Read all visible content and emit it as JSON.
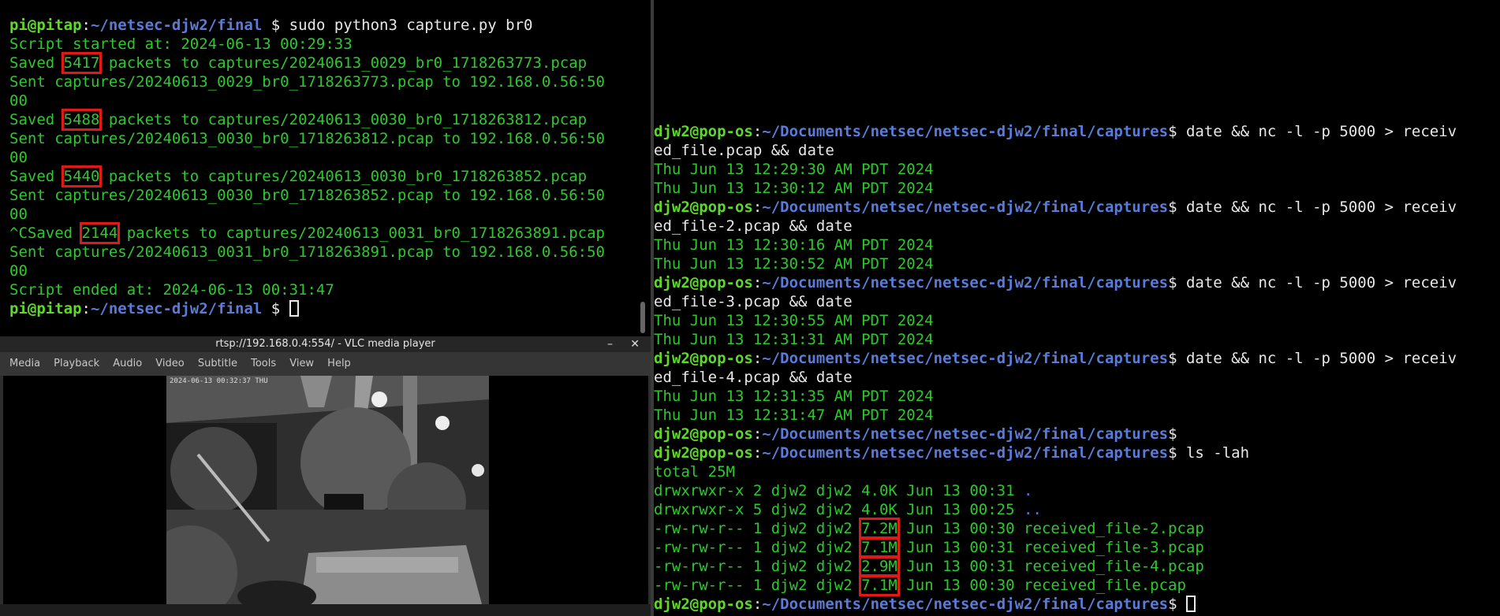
{
  "left_terminal": {
    "lines": [
      [
        {
          "t": "pi@pitap",
          "c": "gb"
        },
        {
          "t": ":",
          "c": "w"
        },
        {
          "t": "~/netsec-djw2/final",
          "c": "bb"
        },
        {
          "t": " $ ",
          "c": "w"
        },
        {
          "t": "sudo python3 capture.py br0",
          "c": "w"
        }
      ],
      [
        {
          "t": "Script started at: 2024-06-13 00:29:33",
          "c": "g"
        }
      ],
      [
        {
          "t": "Saved ",
          "c": "g"
        },
        {
          "t": "5417",
          "c": "g",
          "h": true
        },
        {
          "t": " packets to captures/20240613_0029_br0_1718263773.pcap",
          "c": "g"
        }
      ],
      [
        {
          "t": "Sent captures/20240613_0029_br0_1718263773.pcap to 192.168.0.56:50",
          "c": "g"
        }
      ],
      [
        {
          "t": "00",
          "c": "g"
        }
      ],
      [
        {
          "t": "Saved ",
          "c": "g"
        },
        {
          "t": "5488",
          "c": "g",
          "h": true
        },
        {
          "t": " packets to captures/20240613_0030_br0_1718263812.pcap",
          "c": "g"
        }
      ],
      [
        {
          "t": "Sent captures/20240613_0030_br0_1718263812.pcap to 192.168.0.56:50",
          "c": "g"
        }
      ],
      [
        {
          "t": "00",
          "c": "g"
        }
      ],
      [
        {
          "t": "Saved ",
          "c": "g"
        },
        {
          "t": "5440",
          "c": "g",
          "h": true
        },
        {
          "t": " packets to captures/20240613_0030_br0_1718263852.pcap",
          "c": "g"
        }
      ],
      [
        {
          "t": "Sent captures/20240613_0030_br0_1718263852.pcap to 192.168.0.56:50",
          "c": "g"
        }
      ],
      [
        {
          "t": "00",
          "c": "g"
        }
      ],
      [
        {
          "t": "^CSaved ",
          "c": "g"
        },
        {
          "t": "2144",
          "c": "g",
          "h": true
        },
        {
          "t": " packets to captures/20240613_0031_br0_1718263891.pcap",
          "c": "g"
        }
      ],
      [
        {
          "t": "Sent captures/20240613_0031_br0_1718263891.pcap to 192.168.0.56:50",
          "c": "g"
        }
      ],
      [
        {
          "t": "00",
          "c": "g"
        }
      ],
      [
        {
          "t": "Script ended at: 2024-06-13 00:31:47",
          "c": "g"
        }
      ],
      [
        {
          "t": "pi@pitap",
          "c": "gb"
        },
        {
          "t": ":",
          "c": "w"
        },
        {
          "t": "~/netsec-djw2/final",
          "c": "bb"
        },
        {
          "t": " $ ",
          "c": "w"
        },
        {
          "cursor": true
        }
      ]
    ]
  },
  "right_terminal": {
    "lines": [
      [
        {
          "t": "djw2@pop-os",
          "c": "gb"
        },
        {
          "t": ":",
          "c": "w"
        },
        {
          "t": "~/Documents/netsec/netsec-djw2/final/captures",
          "c": "bb"
        },
        {
          "t": "$ ",
          "c": "w"
        },
        {
          "t": "date && nc -l -p 5000 > receiv",
          "c": "w"
        }
      ],
      [
        {
          "t": "ed_file.pcap && date",
          "c": "w"
        }
      ],
      [
        {
          "t": "Thu Jun 13 12:29:30 AM PDT 2024",
          "c": "g"
        }
      ],
      [
        {
          "t": "Thu Jun 13 12:30:12 AM PDT 2024",
          "c": "g"
        }
      ],
      [
        {
          "t": "djw2@pop-os",
          "c": "gb"
        },
        {
          "t": ":",
          "c": "w"
        },
        {
          "t": "~/Documents/netsec/netsec-djw2/final/captures",
          "c": "bb"
        },
        {
          "t": "$ ",
          "c": "w"
        },
        {
          "t": "date && nc -l -p 5000 > receiv",
          "c": "w"
        }
      ],
      [
        {
          "t": "ed_file-2.pcap && date",
          "c": "w"
        }
      ],
      [
        {
          "t": "Thu Jun 13 12:30:16 AM PDT 2024",
          "c": "g"
        }
      ],
      [
        {
          "t": "Thu Jun 13 12:30:52 AM PDT 2024",
          "c": "g"
        }
      ],
      [
        {
          "t": "djw2@pop-os",
          "c": "gb"
        },
        {
          "t": ":",
          "c": "w"
        },
        {
          "t": "~/Documents/netsec/netsec-djw2/final/captures",
          "c": "bb"
        },
        {
          "t": "$ ",
          "c": "w"
        },
        {
          "t": "date && nc -l -p 5000 > receiv",
          "c": "w"
        }
      ],
      [
        {
          "t": "ed_file-3.pcap && date",
          "c": "w"
        }
      ],
      [
        {
          "t": "Thu Jun 13 12:30:55 AM PDT 2024",
          "c": "g"
        }
      ],
      [
        {
          "t": "Thu Jun 13 12:31:31 AM PDT 2024",
          "c": "g"
        }
      ],
      [
        {
          "t": "djw2@pop-os",
          "c": "gb"
        },
        {
          "t": ":",
          "c": "w"
        },
        {
          "t": "~/Documents/netsec/netsec-djw2/final/captures",
          "c": "bb"
        },
        {
          "t": "$ ",
          "c": "w"
        },
        {
          "t": "date && nc -l -p 5000 > receiv",
          "c": "w"
        }
      ],
      [
        {
          "t": "ed_file-4.pcap && date",
          "c": "w"
        }
      ],
      [
        {
          "t": "Thu Jun 13 12:31:35 AM PDT 2024",
          "c": "g"
        }
      ],
      [
        {
          "t": "Thu Jun 13 12:31:47 AM PDT 2024",
          "c": "g"
        }
      ],
      [
        {
          "t": "djw2@pop-os",
          "c": "gb"
        },
        {
          "t": ":",
          "c": "w"
        },
        {
          "t": "~/Documents/netsec/netsec-djw2/final/captures",
          "c": "bb"
        },
        {
          "t": "$",
          "c": "w"
        }
      ],
      [
        {
          "t": "djw2@pop-os",
          "c": "gb"
        },
        {
          "t": ":",
          "c": "w"
        },
        {
          "t": "~/Documents/netsec/netsec-djw2/final/captures",
          "c": "bb"
        },
        {
          "t": "$ ",
          "c": "w"
        },
        {
          "t": "ls -lah",
          "c": "w"
        }
      ],
      [
        {
          "t": "total 25M",
          "c": "g"
        }
      ],
      [
        {
          "t": "drwxrwxr-x 2 djw2 djw2 4.0K Jun 13 00:31 ",
          "c": "g"
        },
        {
          "t": ".",
          "c": "b"
        }
      ],
      [
        {
          "t": "drwxrwxr-x 5 djw2 djw2 4.0K Jun 13 00:25 ",
          "c": "g"
        },
        {
          "t": "..",
          "c": "b"
        }
      ],
      [
        {
          "t": "-rw-rw-r-- 1 djw2 djw2 ",
          "c": "g"
        },
        {
          "t": "7.2M",
          "c": "g",
          "h": true
        },
        {
          "t": " Jun 13 00:30 received_file-2.pcap",
          "c": "g"
        }
      ],
      [
        {
          "t": "-rw-rw-r-- 1 djw2 djw2 ",
          "c": "g"
        },
        {
          "t": "7.1M",
          "c": "g",
          "h": true
        },
        {
          "t": " Jun 13 00:31 received_file-3.pcap",
          "c": "g"
        }
      ],
      [
        {
          "t": "-rw-rw-r-- 1 djw2 djw2 ",
          "c": "g"
        },
        {
          "t": "2.9M",
          "c": "g",
          "h": true
        },
        {
          "t": " Jun 13 00:31 received_file-4.pcap",
          "c": "g"
        }
      ],
      [
        {
          "t": "-rw-rw-r-- 1 djw2 djw2 ",
          "c": "g"
        },
        {
          "t": "7.1M",
          "c": "g",
          "h": true
        },
        {
          "t": " Jun 13 00:30 received_file.pcap",
          "c": "g"
        }
      ],
      [
        {
          "t": "djw2@pop-os",
          "c": "gb"
        },
        {
          "t": ":",
          "c": "w"
        },
        {
          "t": "~/Documents/netsec/netsec-djw2/final/captures",
          "c": "bb"
        },
        {
          "t": "$ ",
          "c": "w"
        },
        {
          "cursor": true
        }
      ]
    ]
  },
  "vlc": {
    "title": "rtsp://192.168.0.4:554/ - VLC media player",
    "minimize": "–",
    "close": "✕",
    "menu": [
      "Media",
      "Playback",
      "Audio",
      "Video",
      "Subtitle",
      "Tools",
      "View",
      "Help"
    ],
    "camera_timestamp": "2024-06-13 00:32:37 THU"
  },
  "colors": {
    "terminal_bg": "#000000",
    "prompt_user": "#5fd72b",
    "prompt_path": "#5a7bd8",
    "output_text": "#2ec82e",
    "highlight_box": "#e01818"
  }
}
